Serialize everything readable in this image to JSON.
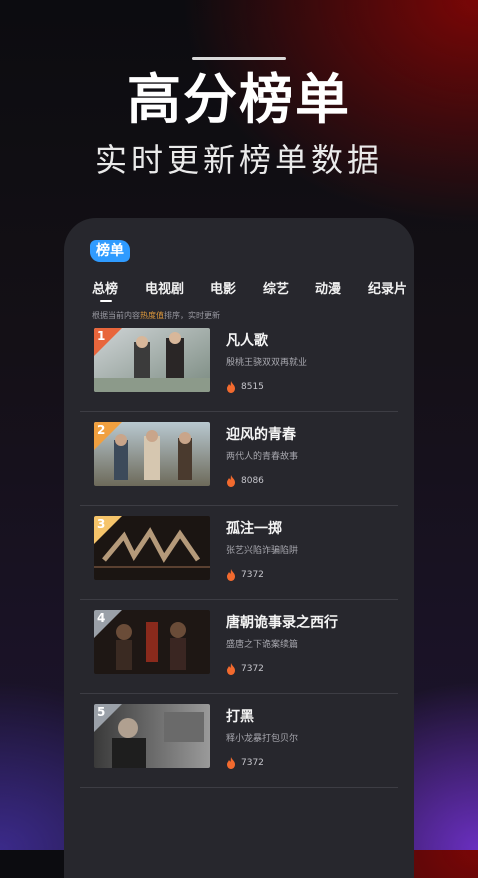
{
  "header": {
    "title": "高分榜单",
    "subtitle": "实时更新榜单数据"
  },
  "app": {
    "logo": "榜单",
    "tabs": [
      "总榜",
      "电视剧",
      "电影",
      "综艺",
      "动漫",
      "纪录片"
    ],
    "active_tab": "总榜",
    "hint_prefix": "根据当前内容",
    "hint_highlight": "热度值",
    "hint_suffix": "排序，实时更新",
    "items": [
      {
        "rank": "1",
        "title": "凡人歌",
        "desc": "殷桃王骁双双再就业",
        "heat": "8515",
        "rank_color": "#e8663c"
      },
      {
        "rank": "2",
        "title": "迎风的青春",
        "desc": "两代人的青春故事",
        "heat": "8086",
        "rank_color": "#f0a040"
      },
      {
        "rank": "3",
        "title": "孤注一掷",
        "desc": "张艺兴陷诈骗陷阱",
        "heat": "7372",
        "rank_color": "#f5c46a"
      },
      {
        "rank": "4",
        "title": "唐朝诡事录之西行",
        "desc": "盛唐之下诡案续篇",
        "heat": "7372",
        "rank_color": "#9aa0a8"
      },
      {
        "rank": "5",
        "title": "打黑",
        "desc": "释小龙暴打包贝尔",
        "heat": "7372",
        "rank_color": "#9aa0a8"
      }
    ]
  },
  "icons": {
    "heat": "flame-icon"
  },
  "colors": {
    "accent": "#2f9bff",
    "flame": "#f26a2e",
    "highlight": "#e09a3c"
  }
}
